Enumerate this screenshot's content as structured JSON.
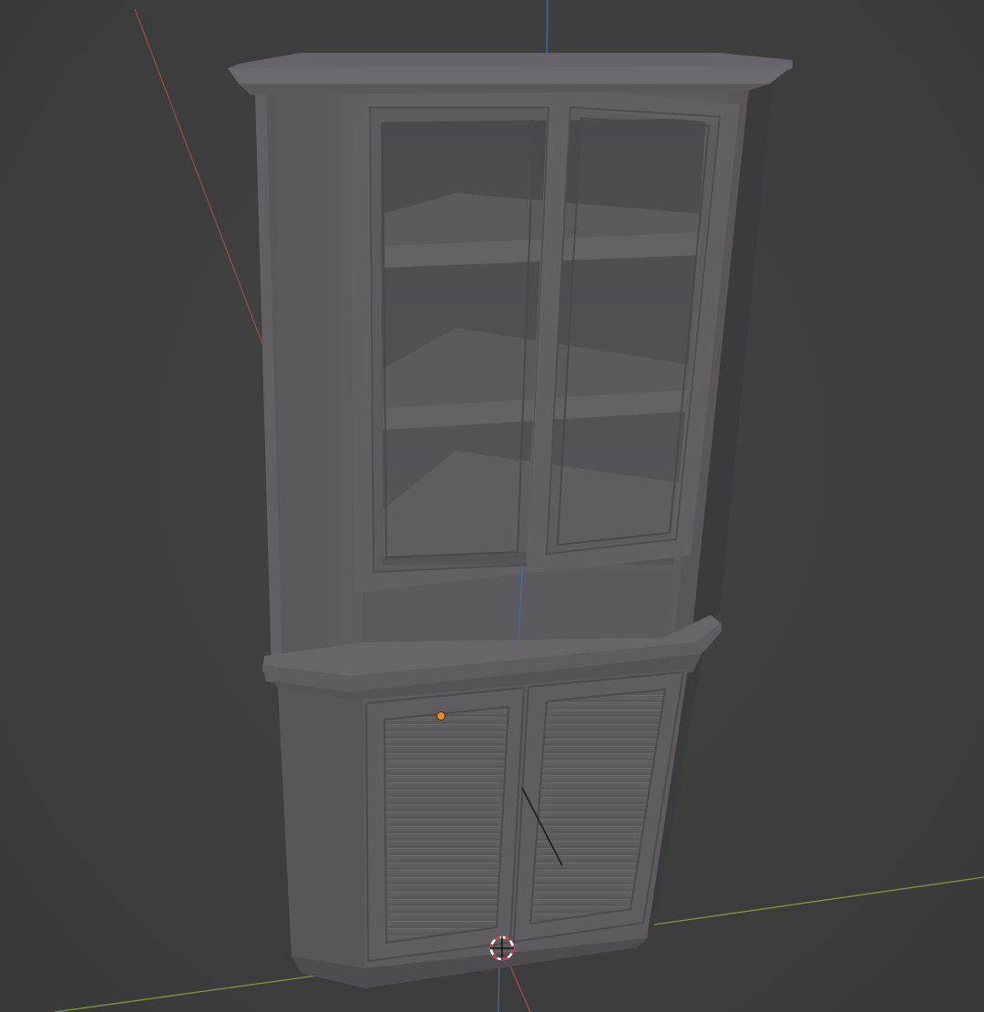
{
  "viewport": {
    "type": "3d-viewport",
    "background": "#3d3d3d",
    "x_axis_color": "#9a4a4a",
    "y_axis_color": "#7a9a3a",
    "z_axis_color": "#3f6fa8",
    "selection_origin_color": "#f08a2a",
    "cursor_color": "#d23a3a"
  },
  "scene": {
    "object": "corner-cabinet",
    "material_color": "#5e5c5f",
    "upper_section": {
      "door_type": "glass",
      "door_count": 2,
      "shelf_count": 3
    },
    "lower_section": {
      "door_type": "louvered",
      "door_count": 2
    }
  }
}
